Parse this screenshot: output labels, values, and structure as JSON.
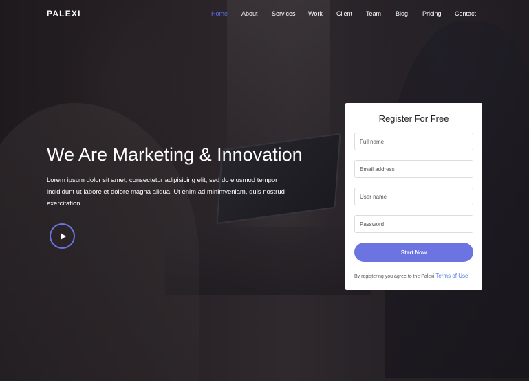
{
  "brand": {
    "logo": "PALEXI"
  },
  "nav": {
    "items": [
      {
        "label": "Home",
        "active": true
      },
      {
        "label": "About"
      },
      {
        "label": "Services"
      },
      {
        "label": "Work"
      },
      {
        "label": "Client"
      },
      {
        "label": "Team"
      },
      {
        "label": "Blog"
      },
      {
        "label": "Pricing"
      },
      {
        "label": "Contact"
      }
    ]
  },
  "hero": {
    "title": "We Are Marketing & Innovation",
    "text": "Lorem ipsum dolor sit amet, consectetur adipisicing elit, sed do eiusmod tempor incididunt ut labore et dolore magna aliqua. Ut enim ad minimveniam, quis nostrud exercitation.",
    "play_icon": "play-icon"
  },
  "register": {
    "title": "Register For Free",
    "full_name_placeholder": "Full name",
    "email_placeholder": "Email address",
    "username_placeholder": "User name",
    "password_placeholder": "Password",
    "submit_label": "Start Now",
    "terms_prefix": "By registering you agree to the Palexi",
    "terms_link": "Terms of Use"
  },
  "colors": {
    "accent": "#6b74e0",
    "active_nav": "#5b6ee6",
    "link": "#4f7ee6"
  }
}
